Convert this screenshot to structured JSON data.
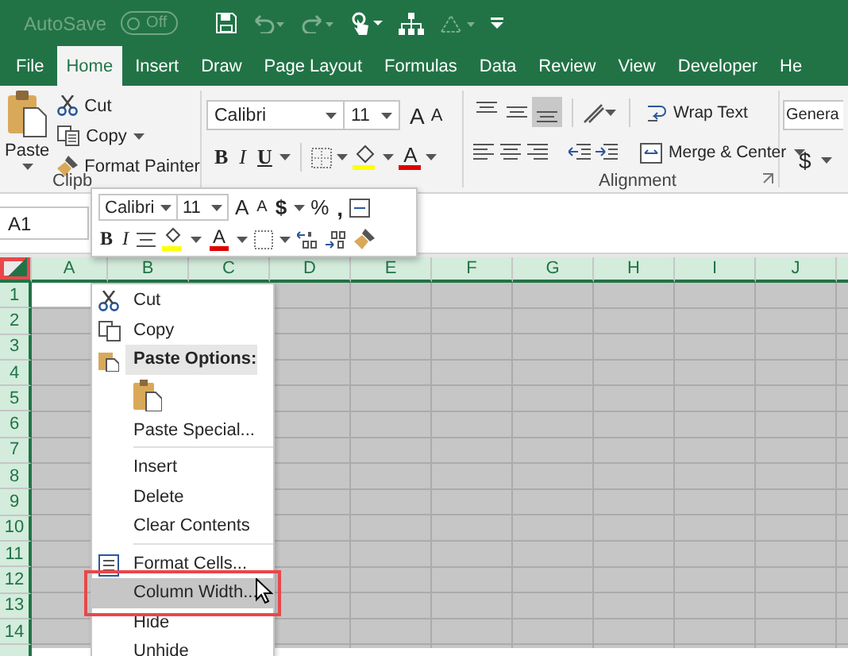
{
  "quick_access": {
    "autosave_label": "AutoSave",
    "autosave": {
      "label": "Off",
      "on": false
    }
  },
  "tabs": [
    {
      "label": "File",
      "selected": false
    },
    {
      "label": "Home",
      "selected": true
    },
    {
      "label": "Insert",
      "selected": false
    },
    {
      "label": "Draw",
      "selected": false
    },
    {
      "label": "Page Layout",
      "selected": false
    },
    {
      "label": "Formulas",
      "selected": false
    },
    {
      "label": "Data",
      "selected": false
    },
    {
      "label": "Review",
      "selected": false
    },
    {
      "label": "View",
      "selected": false
    },
    {
      "label": "Developer",
      "selected": false
    },
    {
      "label": "He",
      "selected": false
    }
  ],
  "ribbon": {
    "clipboard": {
      "paste": "Paste",
      "cut": "Cut",
      "copy": "Copy",
      "format_painter": "Format Painter",
      "group_label": "Clipb"
    },
    "font": {
      "font_name": "Calibri",
      "font_size": "11",
      "grow": "A",
      "shrink": "A",
      "bold": "B",
      "italic": "I",
      "underline": "U",
      "font_color": "A"
    },
    "alignment": {
      "vertical": [
        {
          "selected": false
        },
        {
          "selected": false
        },
        {
          "selected": true
        }
      ],
      "wrap_text": "Wrap Text",
      "merge_center": "Merge & Center",
      "group_label": "Alignment"
    },
    "number": {
      "format": "Genera",
      "currency": "$"
    }
  },
  "name_box": "A1",
  "mini_toolbar": {
    "font_name": "Calibri",
    "font_size": "11",
    "grow": "A",
    "shrink": "A",
    "currency": "$",
    "percent": "%",
    "comma": ",",
    "bold": "B",
    "italic": "I",
    "font_color": "A"
  },
  "sheet": {
    "all_selected": true,
    "columns": [
      "A",
      "B",
      "C",
      "D",
      "E",
      "F",
      "G",
      "H",
      "I",
      "J"
    ],
    "rows": [
      "1",
      "2",
      "3",
      "4",
      "5",
      "6",
      "7",
      "8",
      "9",
      "10",
      "11",
      "12",
      "13",
      "14"
    ]
  },
  "context_menu": {
    "items": [
      {
        "kind": "cut",
        "label": "Cut",
        "selected": false
      },
      {
        "kind": "copy",
        "label": "Copy",
        "selected": false
      },
      {
        "kind": "header",
        "label": "Paste Options:",
        "selected": false
      },
      {
        "kind": "paste",
        "selected": false
      },
      {
        "kind": "command",
        "label": "Paste Special...",
        "selected": false
      },
      {
        "kind": "separator"
      },
      {
        "kind": "command",
        "label": "Insert",
        "selected": false
      },
      {
        "kind": "command",
        "label": "Delete",
        "selected": false
      },
      {
        "kind": "command",
        "label": "Clear Contents",
        "selected": false
      },
      {
        "kind": "separator"
      },
      {
        "kind": "format",
        "label": "Format Cells...",
        "selected": false
      },
      {
        "kind": "command",
        "label": "Column Width...",
        "selected": true
      },
      {
        "kind": "command",
        "label": "Hide",
        "selected": false
      },
      {
        "kind": "command",
        "label": "Unhide",
        "selected": false
      }
    ]
  }
}
